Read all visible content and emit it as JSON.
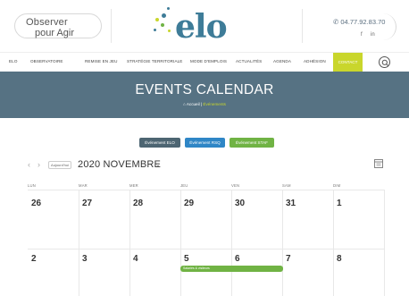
{
  "header": {
    "logo_left_line1": "Observer",
    "logo_left_line2": "pour Agir",
    "logo_main": "elo",
    "phone": "04.77.92.83.70",
    "social_facebook": "f",
    "social_linkedin": "in"
  },
  "nav": {
    "items": [
      "ELO",
      "OBSERVATOIRE",
      "REMISE EN JEU",
      "STRATÉGIE TERRITORIALE",
      "MODE D'EMPLOIS",
      "ACTUALITÉS",
      "AGENDA",
      "ADHÉSION"
    ],
    "contact": "CONTACT"
  },
  "banner": {
    "title": "EVENTS CALENDAR",
    "breadcrumb_home": "Accueil",
    "breadcrumb_sep": "|",
    "breadcrumb_current": "Événements"
  },
  "filters": [
    {
      "label": "Événement ELO",
      "color": "#4d6572"
    },
    {
      "label": "Événement RSQ",
      "color": "#2f86c6"
    },
    {
      "label": "Événement STAF",
      "color": "#70b344"
    }
  ],
  "calendar": {
    "prev": "‹",
    "next": "›",
    "today_label": "Aujourd'hui",
    "month_title": "2020 NOVEMBRE",
    "month_chevron": "⌄",
    "weekdays": [
      "LUN",
      "MAR",
      "MER",
      "JEU",
      "VEN",
      "SAM",
      "DIM"
    ],
    "week1": [
      "26",
      "27",
      "28",
      "29",
      "30",
      "31",
      "1"
    ],
    "week2": [
      "2",
      "3",
      "4",
      "5",
      "6",
      "7",
      "8"
    ],
    "event_label": "Salariés & visiteurs"
  },
  "colors": {
    "accent": "#c9d62c",
    "banner": "#567283",
    "brand_blue": "#3e7c98"
  }
}
